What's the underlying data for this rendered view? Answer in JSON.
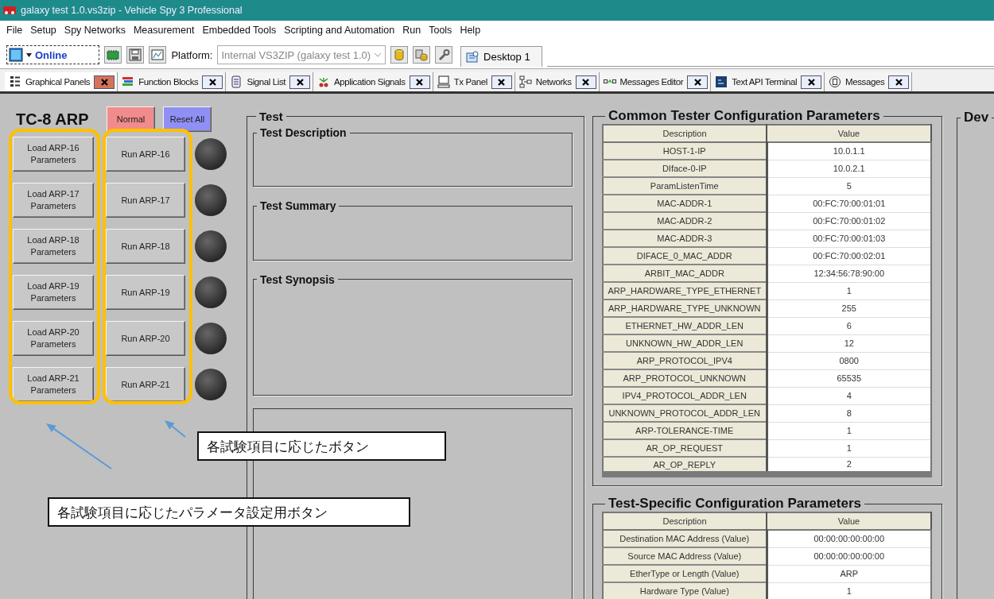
{
  "window": {
    "title": "galaxy test 1.0.vs3zip - Vehicle Spy 3 Professional"
  },
  "menu": [
    "File",
    "Setup",
    "Spy Networks",
    "Measurement",
    "Embedded Tools",
    "Scripting and Automation",
    "Run",
    "Tools",
    "Help"
  ],
  "toolbar": {
    "mode": "Online",
    "platform_label": "Platform:",
    "platform": {
      "value": "Internal VS3ZIP (galaxy test 1.0)",
      "disabled": true
    },
    "desktop_tab": "Desktop 1"
  },
  "tabs": [
    {
      "label": "Graphical Panels",
      "selected": true
    },
    {
      "label": "Function Blocks",
      "selected": false
    },
    {
      "label": "Signal List",
      "selected": false
    },
    {
      "label": "Application Signals",
      "selected": false
    },
    {
      "label": "Tx Panel",
      "selected": false
    },
    {
      "label": "Networks",
      "selected": false
    },
    {
      "label": "Messages Editor",
      "selected": false
    },
    {
      "label": "Text API Terminal",
      "selected": false
    },
    {
      "label": "Messages",
      "selected": false
    }
  ],
  "panel": {
    "title": "TC-8 ARP",
    "buttons": [
      {
        "label": "Normal",
        "color": "#f28b8b"
      },
      {
        "label": "Reset All",
        "color": "#8f8ff5"
      }
    ],
    "tests": [
      {
        "load": "Load ARP-16 Parameters",
        "run": "Run ARP-16",
        "lit": false
      },
      {
        "load": "Load ARP-17 Parameters",
        "run": "Run ARP-17",
        "lit": false
      },
      {
        "load": "Load ARP-18 Parameters",
        "run": "Run ARP-18",
        "lit": false
      },
      {
        "load": "Load ARP-19 Parameters",
        "run": "Run ARP-19",
        "lit": false
      },
      {
        "load": "Load ARP-20 Parameters",
        "run": "Run ARP-20",
        "lit": false
      },
      {
        "load": "Load ARP-21 Parameters",
        "run": "Run ARP-21",
        "lit": false
      }
    ]
  },
  "test_group": {
    "title": "Test",
    "sections": [
      {
        "title": "Test Description"
      },
      {
        "title": "Test Summary"
      },
      {
        "title": "Test Synopsis"
      }
    ]
  },
  "common_params": {
    "title": "Common Tester Configuration Parameters",
    "columns": [
      "Description",
      "Value"
    ],
    "rows": [
      [
        "HOST-1-IP",
        "10.0.1.1"
      ],
      [
        "DIface-0-IP",
        "10.0.2.1"
      ],
      [
        "ParamListenTime",
        "5"
      ],
      [
        "MAC-ADDR-1",
        "00:FC:70:00:01:01"
      ],
      [
        "MAC-ADDR-2",
        "00:FC:70:00:01:02"
      ],
      [
        "MAC-ADDR-3",
        "00:FC:70:00:01:03"
      ],
      [
        "DIFACE_0_MAC_ADDR",
        "00:FC:70:00:02:01"
      ],
      [
        "ARBIT_MAC_ADDR",
        "12:34:56:78:90:00"
      ],
      [
        "ARP_HARDWARE_TYPE_ETHERNET",
        "1"
      ],
      [
        "ARP_HARDWARE_TYPE_UNKNOWN",
        "255"
      ],
      [
        "ETHERNET_HW_ADDR_LEN",
        "6"
      ],
      [
        "UNKNOWN_HW_ADDR_LEN",
        "12"
      ],
      [
        "ARP_PROTOCOL_IPV4",
        "0800"
      ],
      [
        "ARP_PROTOCOL_UNKNOWN",
        "65535"
      ],
      [
        "IPV4_PROTOCOL_ADDR_LEN",
        "4"
      ],
      [
        "UNKNOWN_PROTOCOL_ADDR_LEN",
        "8"
      ],
      [
        "ARP-TOLERANCE-TIME",
        "1"
      ],
      [
        "AR_OP_REQUEST",
        "1"
      ],
      [
        "AR_OP_REPLY",
        "2"
      ]
    ]
  },
  "specific_params": {
    "title": "Test-Specific Configuration Parameters",
    "columns": [
      "Description",
      "Value"
    ],
    "rows": [
      [
        "Destination MAC Address (Value)",
        "00:00:00:00:00:00"
      ],
      [
        "Source MAC Address (Value)",
        "00:00:00:00:00:00"
      ],
      [
        "EtherType or Length (Value)",
        "ARP"
      ],
      [
        "Hardware Type (Value)",
        "1"
      ]
    ]
  },
  "device_group": {
    "title": "Dev"
  },
  "annotations": {
    "callouts": [
      {
        "text": "各試験項目に応じたボタン"
      },
      {
        "text": "各試験項目に応じたパラメータ設定用ボタン"
      }
    ]
  }
}
